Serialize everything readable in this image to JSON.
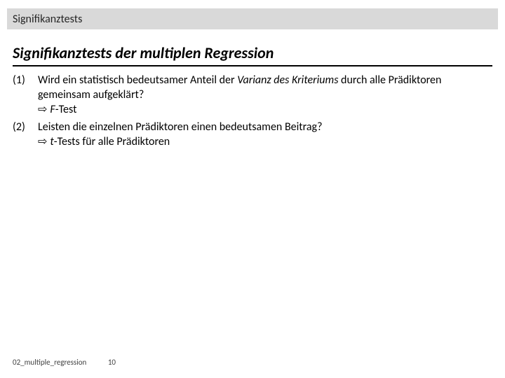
{
  "header": {
    "label": "Signifikanztests"
  },
  "title": {
    "text": "Signifikanztests der multiplen Regression"
  },
  "items": [
    {
      "num": "(1)",
      "pre": "Wird ein statistisch bedeutsamer Anteil der ",
      "em": "Varianz des Kriteriums",
      "post": " durch alle Prädiktoren gemeinsam aufgeklärt?",
      "arrow": "⇨",
      "arrow_em": "F",
      "arrow_post": "-Test"
    },
    {
      "num": "(2)",
      "pre": "Leisten die einzelnen Prädiktoren einen bedeutsamen Beitrag?",
      "em": "",
      "post": "",
      "arrow": "⇨",
      "arrow_em": "t",
      "arrow_post": "-Tests für alle Prädiktoren"
    }
  ],
  "footer": {
    "doc": "02_multiple_regression",
    "page": "10"
  }
}
